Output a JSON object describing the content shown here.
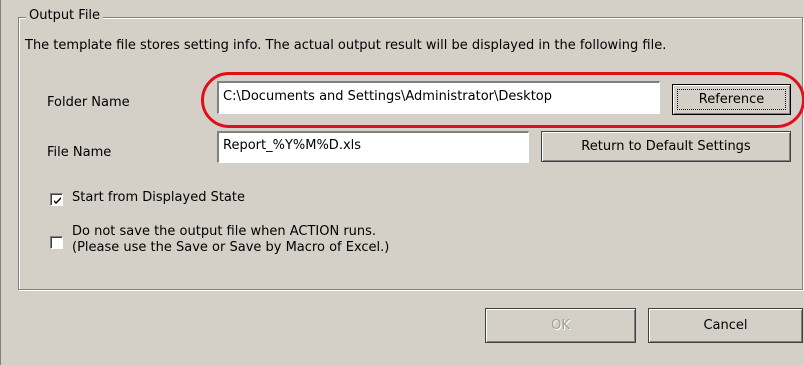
{
  "group": {
    "title": "Output File"
  },
  "description": "The template file stores setting info. The actual output result will be displayed in the following file.",
  "folder": {
    "label": "Folder Name",
    "value": "C:\\Documents and Settings\\Administrator\\Desktop",
    "button": "Reference"
  },
  "file": {
    "label": "File Name",
    "value": "Report_%Y%M%D.xls",
    "button": "Return to Default Settings"
  },
  "options": [
    {
      "label": "Start from Displayed State",
      "checked": true
    },
    {
      "label_line1": "Do not save the output file when ACTION runs.",
      "label_line2": "(Please use the Save or Save by Macro of Excel.)",
      "checked": false
    }
  ],
  "footer": {
    "ok": "OK",
    "cancel": "Cancel",
    "ok_enabled": false
  },
  "colors": {
    "highlight": "#e0101a",
    "face": "#d4d0c8"
  }
}
